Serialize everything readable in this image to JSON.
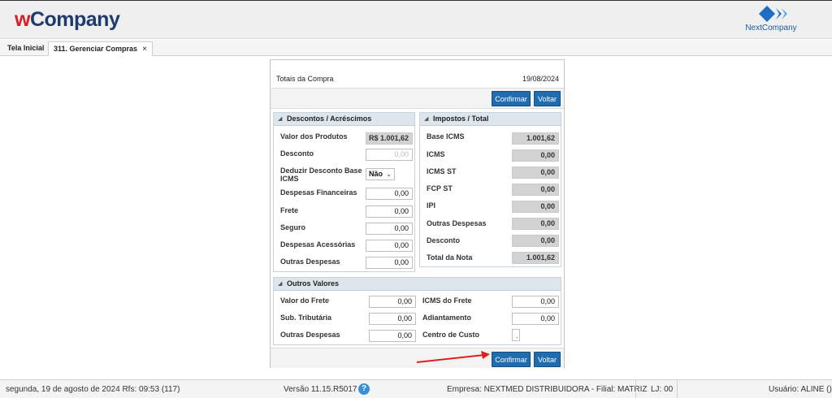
{
  "header": {
    "logo_w": "w",
    "logo_rest": "Company",
    "brand_right": "NextCompany"
  },
  "tabs": [
    {
      "label": "Tela Inicial"
    },
    {
      "label": "311. Gerenciar Compras",
      "close_icon": "×"
    }
  ],
  "dialog": {
    "title": "Totais da Compra",
    "date": "19/08/2024",
    "confirm_label": "Confirmar",
    "back_label": "Voltar",
    "descontos": {
      "title": "Descontos / Acréscimos",
      "valor_produtos_label": "Valor dos Produtos",
      "valor_produtos_value": "R$ 1.001,62",
      "desconto_label": "Desconto",
      "desconto_value": "0,00",
      "deduzir_label": "Deduzir Desconto Base ICMS",
      "deduzir_value": "Não",
      "despesas_fin_label": "Despesas Financeiras",
      "despesas_fin_value": "0,00",
      "frete_label": "Frete",
      "frete_value": "0,00",
      "seguro_label": "Seguro",
      "seguro_value": "0,00",
      "despesas_acess_label": "Despesas Acessórias",
      "despesas_acess_value": "0,00",
      "outras_label": "Outras Despesas",
      "outras_value": "0,00"
    },
    "impostos": {
      "title": "Impostos / Total",
      "base_icms_label": "Base ICMS",
      "base_icms_value": "1.001,62",
      "icms_label": "ICMS",
      "icms_value": "0,00",
      "icms_st_label": "ICMS ST",
      "icms_st_value": "0,00",
      "fcp_st_label": "FCP ST",
      "fcp_st_value": "0,00",
      "ipi_label": "IPI",
      "ipi_value": "0,00",
      "outras_label": "Outras Despesas",
      "outras_value": "0,00",
      "desconto_label": "Desconto",
      "desconto_value": "0,00",
      "total_label": "Total da Nota",
      "total_value": "1.001,62"
    },
    "outros": {
      "title": "Outros Valores",
      "valor_frete_label": "Valor do Frete",
      "valor_frete_value": "0,00",
      "sub_trib_label": "Sub. Tributária",
      "sub_trib_value": "0,00",
      "outras_label": "Outras Despesas",
      "outras_value": "0,00",
      "icms_frete_label": "ICMS do Frete",
      "icms_frete_value": "0,00",
      "adiantamento_label": "Adiantamento",
      "adiantamento_value": "0,00",
      "centro_custo_label": "Centro de Custo",
      "centro_custo_value": ""
    }
  },
  "status": {
    "date": "segunda, 19 de agosto de 2024  Rfs: 09:53 (117)",
    "version": "Versão 11.15.R5017",
    "help": "?",
    "empresa": "Empresa: NEXTMED DISTRIBUIDORA - Filial: MATRIZ",
    "lj": "LJ: 00",
    "usuario": "Usuário: ALINE ()"
  },
  "colors": {
    "primary_button": "#1f6db0",
    "arrow": "#e02020",
    "brand_red": "#d61f26",
    "brand_navy": "#1d3b6e"
  },
  "icons": {
    "collapse": "triangle-down-icon",
    "help": "question-icon",
    "select": "chevron-down-icon"
  }
}
